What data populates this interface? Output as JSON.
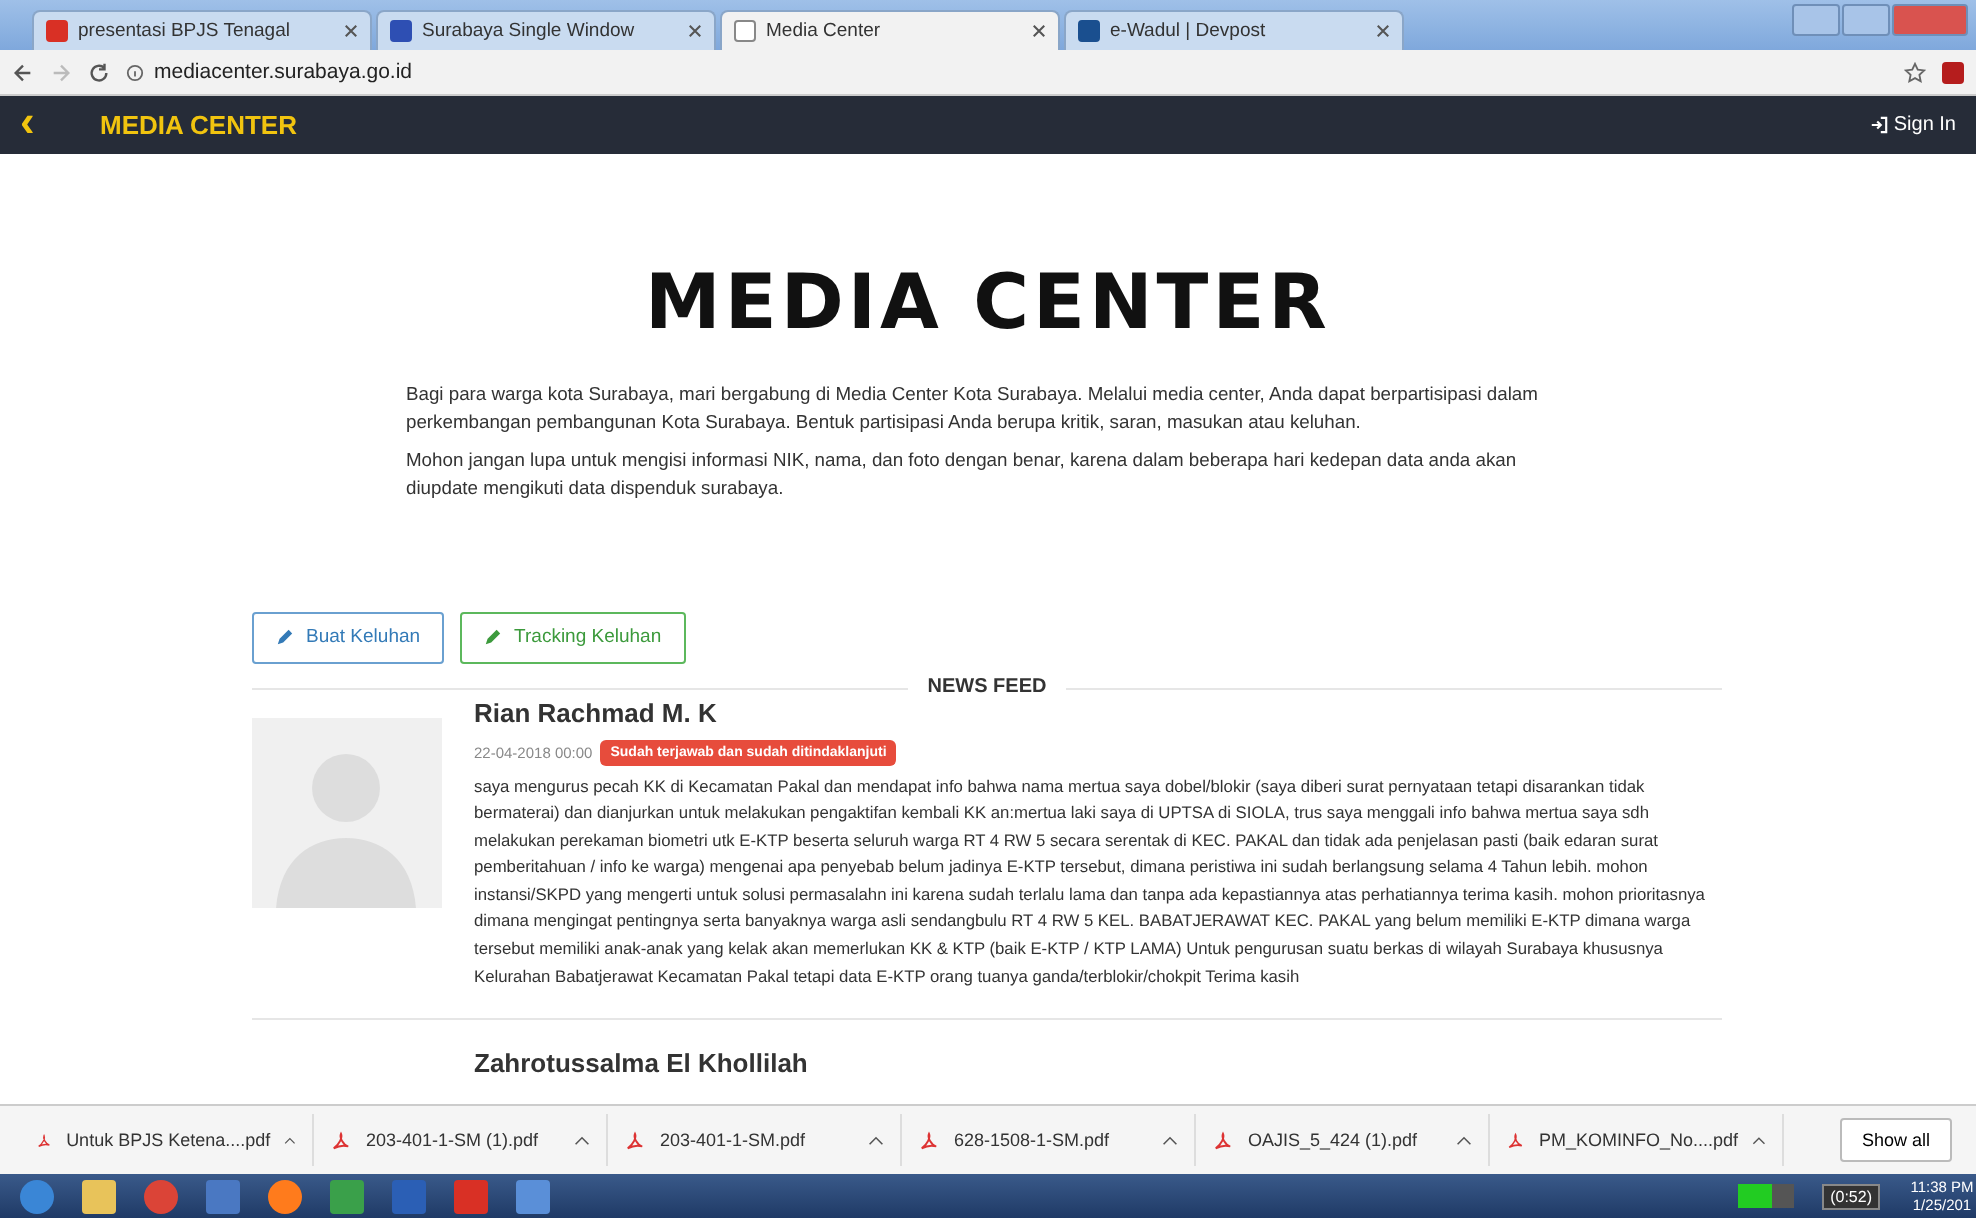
{
  "browser": {
    "tabs": [
      {
        "title": "presentasi BPJS Tenagal",
        "selected": false
      },
      {
        "title": "Surabaya Single Window",
        "selected": false
      },
      {
        "title": "Media Center",
        "selected": true
      },
      {
        "title": "e-Wadul | Devpost",
        "selected": false
      }
    ],
    "url": "mediacenter.surabaya.go.id"
  },
  "navbar": {
    "back": "‹",
    "title": "MEDIA CENTER",
    "sign_in": "Sign In"
  },
  "hero": {
    "title": "MEDIA CENTER",
    "paragraphs": [
      "Bagi para warga kota Surabaya, mari bergabung di Media Center Kota Surabaya. Melalui media center, Anda dapat berpartisipasi dalam perkembangan pembangunan Kota Surabaya. Bentuk partisipasi Anda berupa kritik, saran, masukan atau keluhan.",
      "Mohon jangan lupa untuk mengisi informasi NIK, nama, dan foto dengan benar, karena dalam beberapa hari kedepan data anda akan diupdate mengikuti data dispenduk surabaya."
    ]
  },
  "actions": [
    {
      "label": "Buat Keluhan",
      "kind": "primary"
    },
    {
      "label": "Tracking Keluhan",
      "kind": "success"
    }
  ],
  "news_feed": {
    "heading": "NEWS FEED",
    "posts": [
      {
        "name": "Rian Rachmad M. K",
        "date": "22-04-2018 00:00",
        "status": "Sudah terjawab dan sudah ditindaklanjuti",
        "color": "#e74c3c",
        "text": "saya mengurus pecah KK di Kecamatan Pakal dan mendapat info bahwa nama mertua saya dobel/blokir (saya diberi surat pernyataan tetapi disarankan tidak bermaterai) dan dianjurkan untuk melakukan pengaktifan kembali KK an:mertua laki saya di UPTSA di SIOLA, trus saya menggali info bahwa mertua saya sdh melakukan perekaman biometri utk E-KTP beserta seluruh warga RT 4 RW 5 secara serentak di KEC. PAKAL dan tidak ada penjelasan pasti (baik edaran surat pemberitahuan / info ke warga) mengenai apa penyebab belum jadinya E-KTP tersebut, dimana peristiwa ini sudah berlangsung selama 4 Tahun lebih. mohon instansi/SKPD yang mengerti untuk solusi permasalahn ini karena sudah terlalu lama dan tanpa ada kepastiannya atas perhatiannya terima kasih. mohon prioritasnya dimana mengingat pentingnya serta banyaknya warga asli sendangbulu RT 4 RW 5 KEL. BABATJERAWAT KEC. PAKAL yang belum memiliki E-KTP dimana warga tersebut memiliki anak-anak yang kelak akan memerlukan KK & KTP (baik E-KTP / KTP LAMA) Untuk pengurusan suatu berkas di wilayah Surabaya khususnya Kelurahan Babatjerawat Kecamatan Pakal tetapi data E-KTP orang tuanya ganda/terblokir/chokpit Terima kasih"
      },
      {
        "name": "Zahrotussalma El Khollilah"
      }
    ]
  },
  "downloads": {
    "items": [
      "Untuk BPJS Ketena....pdf",
      "203-401-1-SM (1).pdf",
      "203-401-1-SM.pdf",
      "628-1508-1-SM.pdf",
      "OAJIS_5_424 (1).pdf",
      "PM_KOMINFO_No....pdf"
    ],
    "show_all": "Show all"
  },
  "taskbar": {
    "timer": "(0:52)",
    "time": "11:38 PM",
    "date": "1/25/201"
  }
}
